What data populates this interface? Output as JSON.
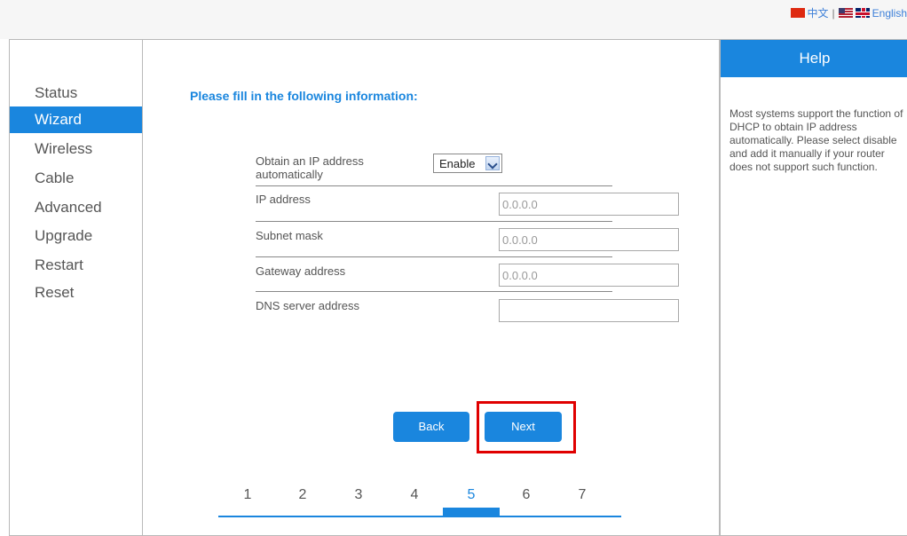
{
  "lang": {
    "chinese": "中文",
    "separator": "|",
    "english": "English"
  },
  "nav": {
    "items": [
      {
        "label": "Status"
      },
      {
        "label": "Wizard"
      },
      {
        "label": "Wireless"
      },
      {
        "label": "Cable"
      },
      {
        "label": "Advanced"
      },
      {
        "label": "Upgrade"
      },
      {
        "label": "Restart"
      },
      {
        "label": "Reset"
      }
    ],
    "active": "Wizard"
  },
  "form": {
    "heading": "Please fill in the following information:",
    "obtain_ip_label": "Obtain an IP address automatically",
    "obtain_ip_value": "Enable",
    "ip_label": "IP address",
    "ip_value": "0.0.0.0",
    "subnet_label": "Subnet mask",
    "subnet_value": "0.0.0.0",
    "gateway_label": "Gateway address",
    "gateway_value": "0.0.0.0",
    "dns_label": "DNS server address",
    "dns_value": ""
  },
  "buttons": {
    "back": "Back",
    "next": "Next"
  },
  "steps": {
    "items": [
      "1",
      "2",
      "3",
      "4",
      "5",
      "6",
      "7"
    ],
    "current": "5"
  },
  "help": {
    "title": "Help",
    "text": "Most systems support the function of DHCP to obtain IP address automatically. Please select disable and add it manually if your router does not support such function."
  },
  "colors": {
    "accent": "#1a86de",
    "highlight": "#e00000"
  }
}
